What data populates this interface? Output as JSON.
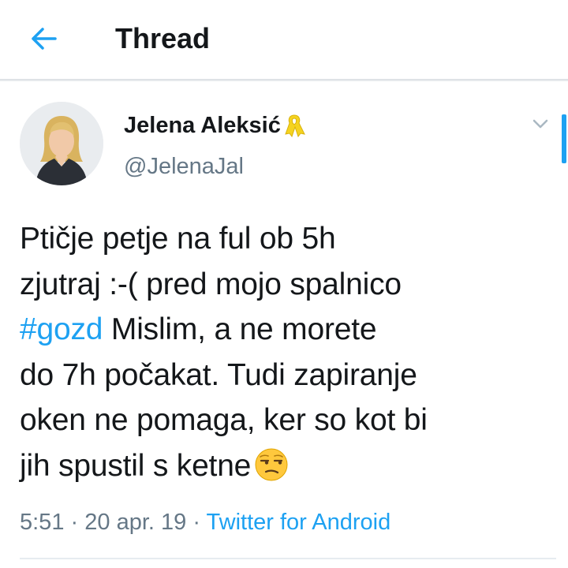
{
  "header": {
    "back_icon": "arrow-left-icon",
    "title": "Thread"
  },
  "tweet": {
    "author": {
      "display_name": "Jelena Aleksić",
      "badge_icon": "yellow-ribbon-icon",
      "handle": "@JelenaJal"
    },
    "menu_icon": "chevron-down-icon",
    "text_lines": [
      [
        "Ptičje petje na ful ob 5h"
      ],
      [
        "zjutraj :-( pred mojo spalnico"
      ],
      [
        "#gozd",
        " Mislim, a ne morete"
      ],
      [
        "do 7h počakat. Tudi zapiranje"
      ],
      [
        "oken ne pomaga, ker so kot bi"
      ],
      [
        "jih spustil s ketne",
        "unamused-face-emoji"
      ]
    ],
    "hashtag": "#gozd",
    "time": "5:51",
    "separator": "·",
    "date": "20 apr. 19",
    "source": "Twitter for Android"
  },
  "colors": {
    "accent": "#1da1f2",
    "secondary_text": "#657786",
    "primary_text": "#14171a",
    "ribbon": "#f5d31f"
  }
}
